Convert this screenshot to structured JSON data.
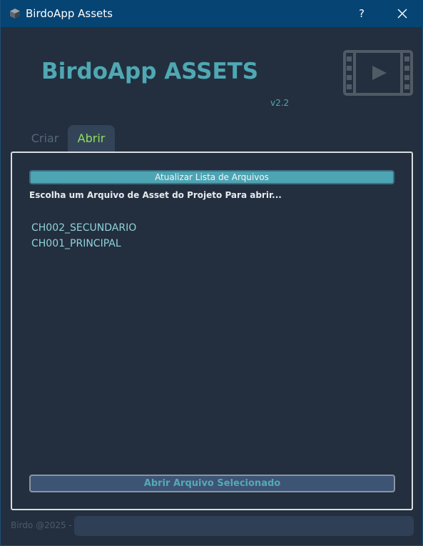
{
  "window": {
    "title": "BirdoApp Assets",
    "help_label": "?"
  },
  "header": {
    "title": "BirdoApp ASSETS",
    "version": "v2.2",
    "logo_icon": "film-play-icon"
  },
  "tabs": [
    {
      "label": "Criar",
      "active": false
    },
    {
      "label": "Abrir",
      "active": true
    }
  ],
  "panel": {
    "refresh_label": "Atualizar Lista de Arquivos",
    "instructions": "Escolha um Arquivo de Asset do Projeto Para abrir...",
    "files": [
      "CH002_SECUNDARIO",
      "CH001_PRINCIPAL"
    ],
    "open_label": "Abrir Arquivo Selecionado"
  },
  "footer": {
    "credit": "Birdo @2025 -",
    "status": ""
  },
  "colors": {
    "background": "#232f3e",
    "titlebar": "#064473",
    "accent": "#4fa8b4",
    "active_tab_text": "#8fe05a"
  }
}
